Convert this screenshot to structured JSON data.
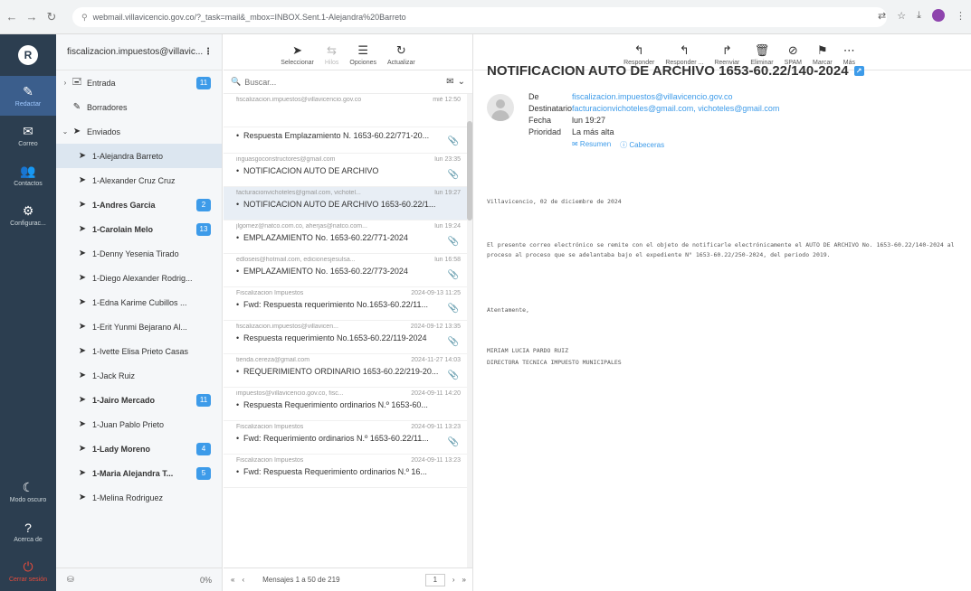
{
  "browser": {
    "url": "webmail.villavicencio.gov.co/?_task=mail&_mbox=INBOX.Sent.1-Alejandra%20Barreto"
  },
  "rail": {
    "logo": "R",
    "items": [
      {
        "icon": "✎",
        "label": "Redactar",
        "active": true
      },
      {
        "icon": "✉",
        "label": "Correo"
      },
      {
        "icon": "👥",
        "label": "Contactos"
      },
      {
        "icon": "⚙",
        "label": "Configurac..."
      }
    ],
    "bottom": [
      {
        "icon": "☾",
        "label": "Modo oscuro"
      },
      {
        "icon": "?",
        "label": "Acerca de"
      },
      {
        "icon": "⏻",
        "label": "Cerrar sesión"
      }
    ]
  },
  "account": "fiscalizacion.impuestos@villavic...",
  "folders": [
    {
      "label": "Entrada",
      "icon": "inbox",
      "caret": "›",
      "badge": "11",
      "level": 0
    },
    {
      "label": "Borradores",
      "icon": "pencil",
      "level": 0
    },
    {
      "label": "Enviados",
      "icon": "send",
      "caret": "⌄",
      "level": 0
    },
    {
      "label": "1-Alejandra Barreto",
      "icon": "send",
      "level": 1,
      "selected": true
    },
    {
      "label": "1-Alexander Cruz Cruz",
      "icon": "send",
      "level": 1
    },
    {
      "label": "1-Andres Garcia",
      "icon": "send",
      "level": 1,
      "bold": true,
      "badge": "2"
    },
    {
      "label": "1-Carolain Melo",
      "icon": "send",
      "level": 1,
      "bold": true,
      "badge": "13"
    },
    {
      "label": "1-Denny Yesenia Tirado",
      "icon": "send",
      "level": 1
    },
    {
      "label": "1-Diego Alexander Rodrig...",
      "icon": "send",
      "level": 1
    },
    {
      "label": "1-Edna Karime Cubillos ...",
      "icon": "send",
      "level": 1
    },
    {
      "label": "1-Erit Yunmi Bejarano Al...",
      "icon": "send",
      "level": 1
    },
    {
      "label": "1-Ivette Elisa Prieto Casas",
      "icon": "send",
      "level": 1
    },
    {
      "label": "1-Jack Ruiz",
      "icon": "send",
      "level": 1
    },
    {
      "label": "1-Jairo Mercado",
      "icon": "send",
      "level": 1,
      "bold": true,
      "badge": "11"
    },
    {
      "label": "1-Juan Pablo Prieto",
      "icon": "send",
      "level": 1
    },
    {
      "label": "1-Lady Moreno",
      "icon": "send",
      "level": 1,
      "bold": true,
      "badge": "4"
    },
    {
      "label": "1-Maria Alejandra T...",
      "icon": "send",
      "level": 1,
      "bold": true,
      "badge": "5"
    },
    {
      "label": "1-Melina Rodriguez",
      "icon": "send",
      "level": 1
    }
  ],
  "folder_footer": {
    "percent": "0%"
  },
  "list_toolbar": [
    {
      "icon": "➤",
      "label": "Seleccionar"
    },
    {
      "icon": "⇆",
      "label": "Hilos",
      "disabled": true
    },
    {
      "icon": "☰",
      "label": "Opciones"
    },
    {
      "icon": "↻",
      "label": "Actualizar"
    }
  ],
  "search": {
    "placeholder": "Buscar..."
  },
  "messages": [
    {
      "from": "fiscalizacion.impuestos@villavicencio.gov.co",
      "date": "mié 12:50",
      "subject": "",
      "first": true
    },
    {
      "from": "",
      "date": "",
      "subject": "Respuesta Emplazamiento N. 1653-60.22/771-20...",
      "clip": true,
      "subjectOnly": true
    },
    {
      "from": "inguasgoconstructores@gmail.com",
      "date": "lun 23:35",
      "subject": "NOTIFICACION AUTO DE ARCHIVO",
      "clip": true
    },
    {
      "from": "facturacionvichoteles@gmail.com, vichotel...",
      "date": "lun 19:27",
      "subject": "NOTIFICACION AUTO DE ARCHIVO 1653-60.22/1...",
      "selected": true
    },
    {
      "from": "jlgomez@natco.com.co, aherjas@natco.com...",
      "date": "lun 19:24",
      "subject": "EMPLAZAMIENTO No. 1653-60.22/771-2024",
      "clip": true
    },
    {
      "from": "edloseis@hotmail.com, edicionesjesulsa...",
      "date": "lun 16:58",
      "subject": "EMPLAZAMIENTO No. 1653-60.22/773-2024",
      "clip": true
    },
    {
      "from": "Fiscalizacion Impuestos",
      "date": "2024-09-13 11:25",
      "subject": "Fwd: Respuesta requerimiento No.1653-60.22/11...",
      "clip": true
    },
    {
      "from": "fiscalizacion.impuestos@villavicen...",
      "date": "2024-09-12 13:35",
      "subject": "Respuesta requerimiento No.1653-60.22/119-2024",
      "clip": true
    },
    {
      "from": "tienda.cereza@gmail.com",
      "date": "2024-11-27 14:03",
      "subject": "REQUERIMIENTO ORDINARIO 1653-60.22/219-20...",
      "clip": true
    },
    {
      "from": "impuestos@villavicencio.gov.co, fisc...",
      "date": "2024-09-11 14:20",
      "subject": "Respuesta Requerimiento ordinarios N.º 1653-60...",
      "clip": false
    },
    {
      "from": "Fiscalizacion Impuestos",
      "date": "2024-09-11 13:23",
      "subject": "Fwd: Requerimiento ordinarios N.º 1653-60.22/11...",
      "clip": true
    },
    {
      "from": "Fiscalizacion Impuestos",
      "date": "2024-09-11 13:23",
      "subject": "Fwd: Respuesta Requerimiento ordinarios N.º 16..."
    }
  ],
  "list_footer": {
    "prev": "«",
    "prev1": "‹",
    "count": "Mensajes 1 a 50 de 219",
    "page": "1",
    "next1": "›",
    "next": "»"
  },
  "reader_toolbar": [
    {
      "icon": "↰",
      "label": "Responder"
    },
    {
      "icon": "↰",
      "label": "Responder ..."
    },
    {
      "icon": "↱",
      "label": "Reenviar"
    },
    {
      "icon": "🗑",
      "label": "Eliminar"
    },
    {
      "icon": "⊘",
      "label": "SPAM"
    },
    {
      "icon": "⚑",
      "label": "Marcar"
    },
    {
      "icon": "⋯",
      "label": "Más"
    }
  ],
  "reader": {
    "title": "NOTIFICACION AUTO DE ARCHIVO 1653-60.22/140-2024",
    "headers": [
      {
        "label": "De",
        "value": "fiscalizacion.impuestos@villavicencio.gov.co",
        "link": true
      },
      {
        "label": "Destinatario",
        "value": "facturacionvichoteles@gmail.com, vichoteles@gmail.com",
        "link": true
      },
      {
        "label": "Fecha",
        "value": "lun 19:27"
      },
      {
        "label": "Prioridad",
        "value": "La más alta"
      }
    ],
    "actions": [
      "Resumen",
      "Cabeceras"
    ],
    "body": [
      "Villavicencio, 02 de diciembre de 2024",
      "El presente correo electrónico se remite con el objeto de notificarle electrónicamente el AUTO DE ARCHIVO No. 1653-60.22/140-2024 al proceso al proceso que se adelantaba bajo el expediente N° 1653-60.22/250-2024, del periodo 2019.",
      "Atentamente,",
      "MIRIAM LUCIA PARDO RUIZ",
      "DIRECTORA TECNICA IMPUESTO MUNICIPALES"
    ]
  }
}
